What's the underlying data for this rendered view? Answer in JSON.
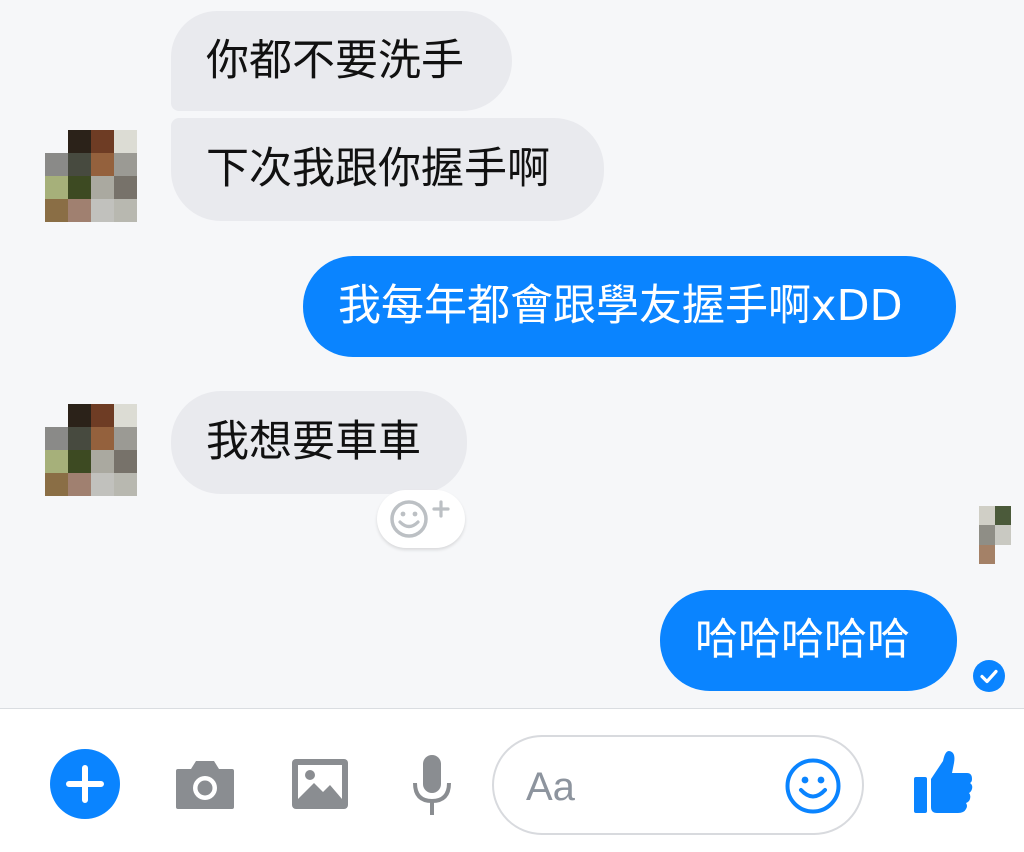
{
  "messages": [
    {
      "id": "m1",
      "side": "incoming",
      "text": "你都不要洗手"
    },
    {
      "id": "m2",
      "side": "incoming",
      "text": "下次我跟你握手啊"
    },
    {
      "id": "m3",
      "side": "outgoing",
      "text": "我每年都會跟學友握手啊xDD"
    },
    {
      "id": "m4",
      "side": "incoming",
      "text": "我想要車車"
    },
    {
      "id": "m5",
      "side": "outgoing",
      "text": "哈哈哈哈哈"
    }
  ],
  "composer": {
    "placeholder": "Aa",
    "icons": [
      "plus-icon",
      "camera-icon",
      "image-icon",
      "microphone-icon",
      "emoji-icon",
      "thumbs-up-icon"
    ]
  },
  "reaction_button": {
    "icon": "add-reaction-icon"
  },
  "read_receipt": {
    "icon": "checkmark-icon",
    "status": "delivered"
  },
  "colors": {
    "accent": "#0a84ff",
    "incoming_bubble": "#e9eaee",
    "background": "#f6f7f9"
  }
}
